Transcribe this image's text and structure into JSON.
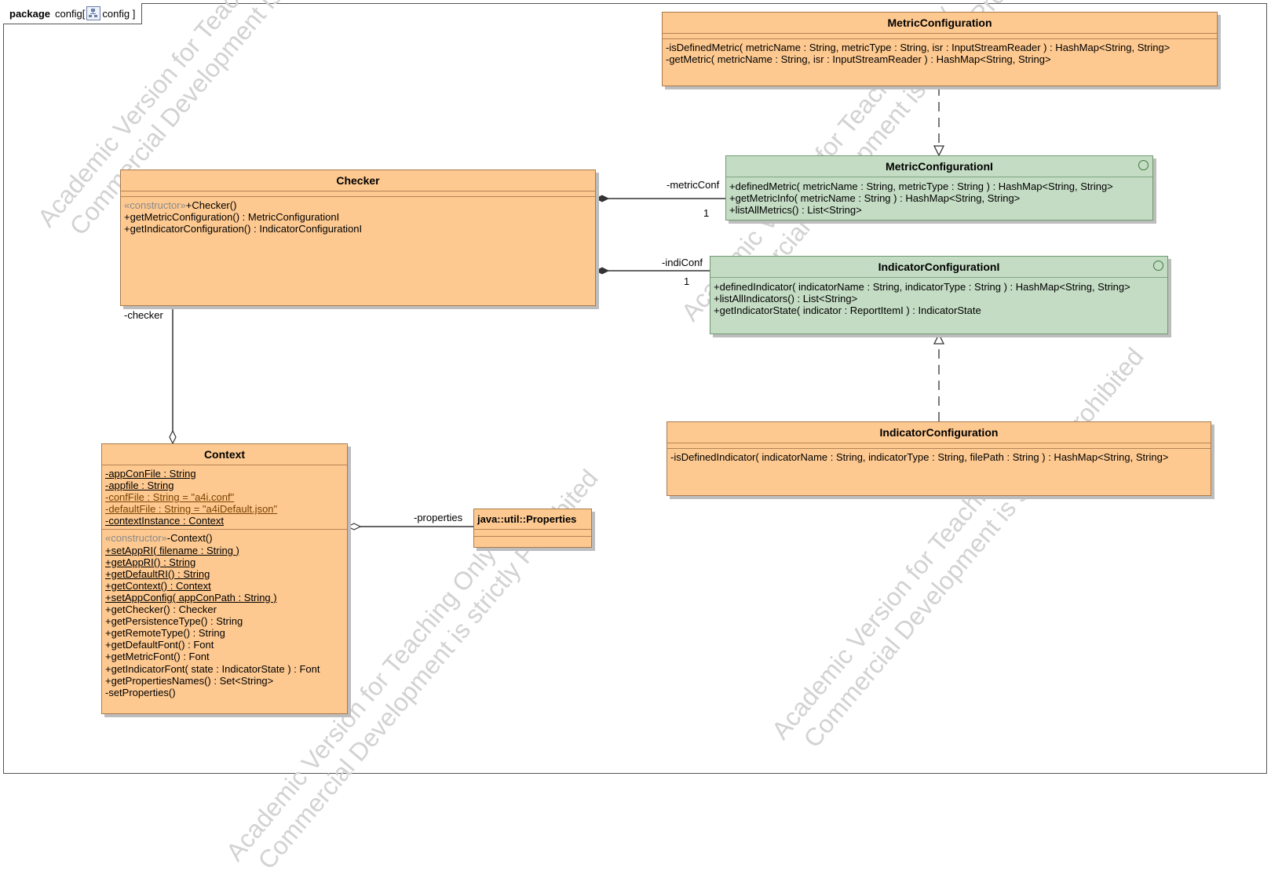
{
  "package": {
    "keyword": "package",
    "name": "config",
    "diagram_name": "config"
  },
  "watermark": {
    "line1a": "Academic Version for Teaching Only",
    "line1b": "Commercial Development is strictly Prohibited"
  },
  "classes": {
    "metric_configuration": {
      "name": "MetricConfiguration",
      "operations": [
        "-isDefinedMetric( metricName : String, metricType : String, isr : InputStreamReader ) : HashMap<String, String>",
        "-getMetric( metricName : String, isr : InputStreamReader ) : HashMap<String, String>"
      ]
    },
    "metric_configuration_i": {
      "name": "MetricConfigurationI",
      "operations": [
        "+definedMetric( metricName : String, metricType : String ) : HashMap<String, String>",
        "+getMetricInfo( metricName : String ) : HashMap<String, String>",
        "+listAllMetrics() : List<String>"
      ]
    },
    "checker": {
      "name": "Checker",
      "constructor_stereotype": "«constructor»",
      "constructor": "+Checker()",
      "operations": [
        "+getMetricConfiguration() : MetricConfigurationI",
        "+getIndicatorConfiguration() : IndicatorConfigurationI"
      ]
    },
    "indicator_configuration_i": {
      "name": "IndicatorConfigurationI",
      "operations": [
        "+definedIndicator( indicatorName : String, indicatorType : String ) : HashMap<String, String>",
        "+listAllIndicators() : List<String>",
        "+getIndicatorState( indicator : ReportItemI ) : IndicatorState"
      ]
    },
    "indicator_configuration": {
      "name": "IndicatorConfiguration",
      "operations": [
        "-isDefinedIndicator( indicatorName : String, indicatorType : String, filePath : String ) : HashMap<String, String>"
      ]
    },
    "context": {
      "name": "Context",
      "attributes": [
        "-appConFile : String",
        "-appfile : String",
        "-confFile : String = \"a4i.conf\"",
        "-defaultFile : String = \"a4iDefault.json\"",
        "-contextInstance : Context"
      ],
      "constructor_stereotype": "«constructor»",
      "constructor": "-Context()",
      "static_operations": [
        "+setAppRI( filename : String )",
        "+getAppRI() : String",
        "+getDefaultRI() : String",
        "+getContext() : Context",
        "+setAppConfig( appConPath : String )"
      ],
      "operations": [
        "+getChecker() : Checker",
        "+getPersistenceType() : String",
        "+getRemoteType() : String",
        "+getDefaultFont() : Font",
        "+getMetricFont() : Font",
        "+getIndicatorFont( state : IndicatorState ) : Font",
        "+getPropertiesNames() : Set<String>",
        "-setProperties()"
      ]
    },
    "properties": {
      "name": "java::util::Properties"
    }
  },
  "associations": {
    "metric_conf": {
      "role": "-metricConf",
      "multiplicity": "1"
    },
    "indi_conf": {
      "role": "-indiConf",
      "multiplicity": "1"
    },
    "checker": {
      "role": "-checker"
    },
    "properties": {
      "role": "-properties"
    }
  }
}
